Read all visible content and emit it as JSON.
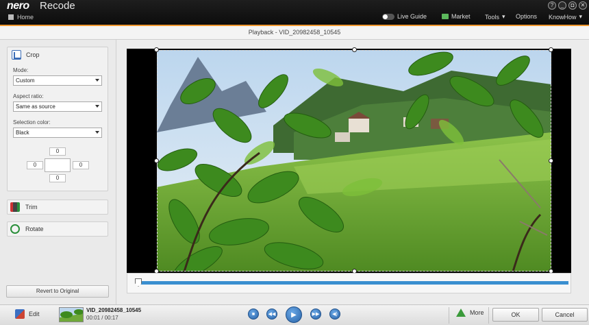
{
  "app": {
    "logo": "nero",
    "name": "Recode",
    "home_label": "Home"
  },
  "menu": {
    "live_guide": "Live Guide",
    "market": "Market",
    "tools": "Tools",
    "options": "Options",
    "knowhow": "KnowHow"
  },
  "window_controls": {
    "help": "?",
    "restore": "◘",
    "close": "✕"
  },
  "subheader": {
    "title": "Playback - VID_20982458_10545"
  },
  "crop": {
    "title": "Crop",
    "mode_label": "Mode:",
    "mode_value": "Custom",
    "aspect_label": "Aspect ratio:",
    "aspect_value": "Same as source",
    "color_label": "Selection color:",
    "color_value": "Black",
    "top": "0",
    "left": "0",
    "right": "0",
    "bottom": "0"
  },
  "trim": {
    "label": "Trim"
  },
  "rotate": {
    "label": "Rotate"
  },
  "revert": {
    "label": "Revert to Original"
  },
  "bottom": {
    "edit_label": "Edit",
    "clip_name": "VID_20982458_10545",
    "clip_time": "00:01 / 00:17",
    "more_label": "More",
    "ok_label": "OK",
    "cancel_label": "Cancel"
  },
  "colors": {
    "accent": "#f0962d",
    "timeline": "#3a8fd0",
    "titlebar": "#111111"
  }
}
